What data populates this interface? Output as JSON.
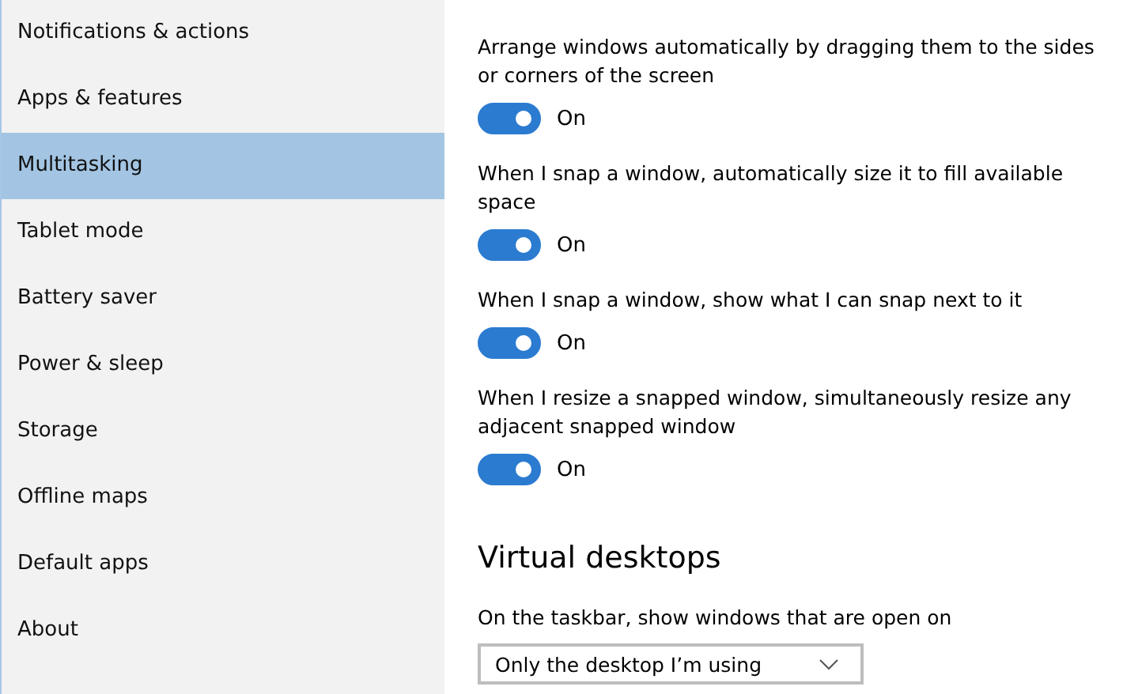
{
  "sidebar": {
    "items": [
      {
        "label": "Notifications & actions",
        "selected": false
      },
      {
        "label": "Apps & features",
        "selected": false
      },
      {
        "label": "Multitasking",
        "selected": true
      },
      {
        "label": "Tablet mode",
        "selected": false
      },
      {
        "label": "Battery saver",
        "selected": false
      },
      {
        "label": "Power & sleep",
        "selected": false
      },
      {
        "label": "Storage",
        "selected": false
      },
      {
        "label": "Offline maps",
        "selected": false
      },
      {
        "label": "Default apps",
        "selected": false
      },
      {
        "label": "About",
        "selected": false
      }
    ]
  },
  "snap_settings": [
    {
      "description": "Arrange windows automatically by dragging them to the sides or corners of the screen",
      "on": true,
      "state_label": "On"
    },
    {
      "description": "When I snap a window, automatically size it to fill available space",
      "on": true,
      "state_label": "On"
    },
    {
      "description": "When I snap a window, show what I can snap next to it",
      "on": true,
      "state_label": "On"
    },
    {
      "description": "When I resize a snapped window, simultaneously resize any adjacent snapped window",
      "on": true,
      "state_label": "On"
    }
  ],
  "virtual_desktops": {
    "heading": "Virtual desktops",
    "label": "On the taskbar, show windows that are open on",
    "dropdown": {
      "value": "Only the desktop I’m using"
    }
  }
}
